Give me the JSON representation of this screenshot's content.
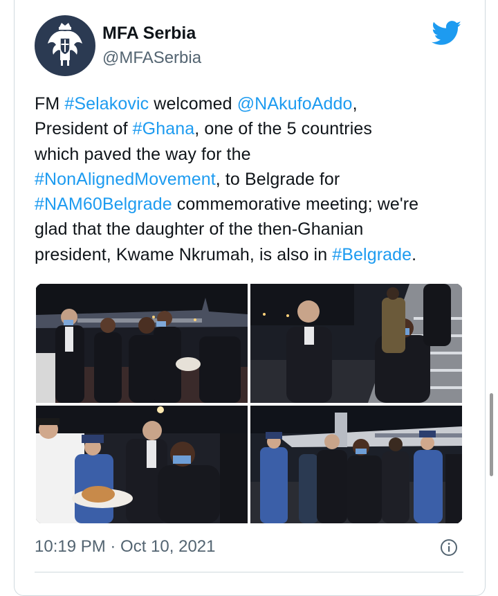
{
  "tweet": {
    "display_name": "MFA Serbia",
    "handle": "@MFASerbia",
    "text_segments": [
      {
        "t": "FM ",
        "link": false
      },
      {
        "t": "#Selakovic",
        "link": true
      },
      {
        "t": " welcomed ",
        "link": false
      },
      {
        "t": "@NAkufoAddo",
        "link": true
      },
      {
        "t": ",\nPresident of ",
        "link": false
      },
      {
        "t": "#Ghana",
        "link": true
      },
      {
        "t": ", one of the 5 countries\nwhich paved the way for the\n",
        "link": false
      },
      {
        "t": "#NonAlignedMovement",
        "link": true
      },
      {
        "t": ", to Belgrade for\n",
        "link": false
      },
      {
        "t": "#NAM60Belgrade",
        "link": true
      },
      {
        "t": " commemorative meeting; we're\nglad that the daughter of the then-Ghanian\npresident, Kwame Nkrumah, is also in ",
        "link": false
      },
      {
        "t": "#Belgrade",
        "link": true
      },
      {
        "t": ".",
        "link": false
      }
    ],
    "timestamp": "10:19 PM · Oct 10, 2021",
    "media": [
      {
        "name": "photo-welcome-handshake"
      },
      {
        "name": "photo-airplane-stairs"
      },
      {
        "name": "photo-bread-and-salt"
      },
      {
        "name": "photo-honor-guard"
      }
    ]
  },
  "icons": {
    "bird": "twitter-bird-icon",
    "info": "info-icon",
    "avatar": "serbian-coat-of-arms"
  },
  "colors": {
    "link": "#1d9bf0",
    "text": "#0f1419",
    "muted": "#536471",
    "border": "#cfd9de"
  }
}
